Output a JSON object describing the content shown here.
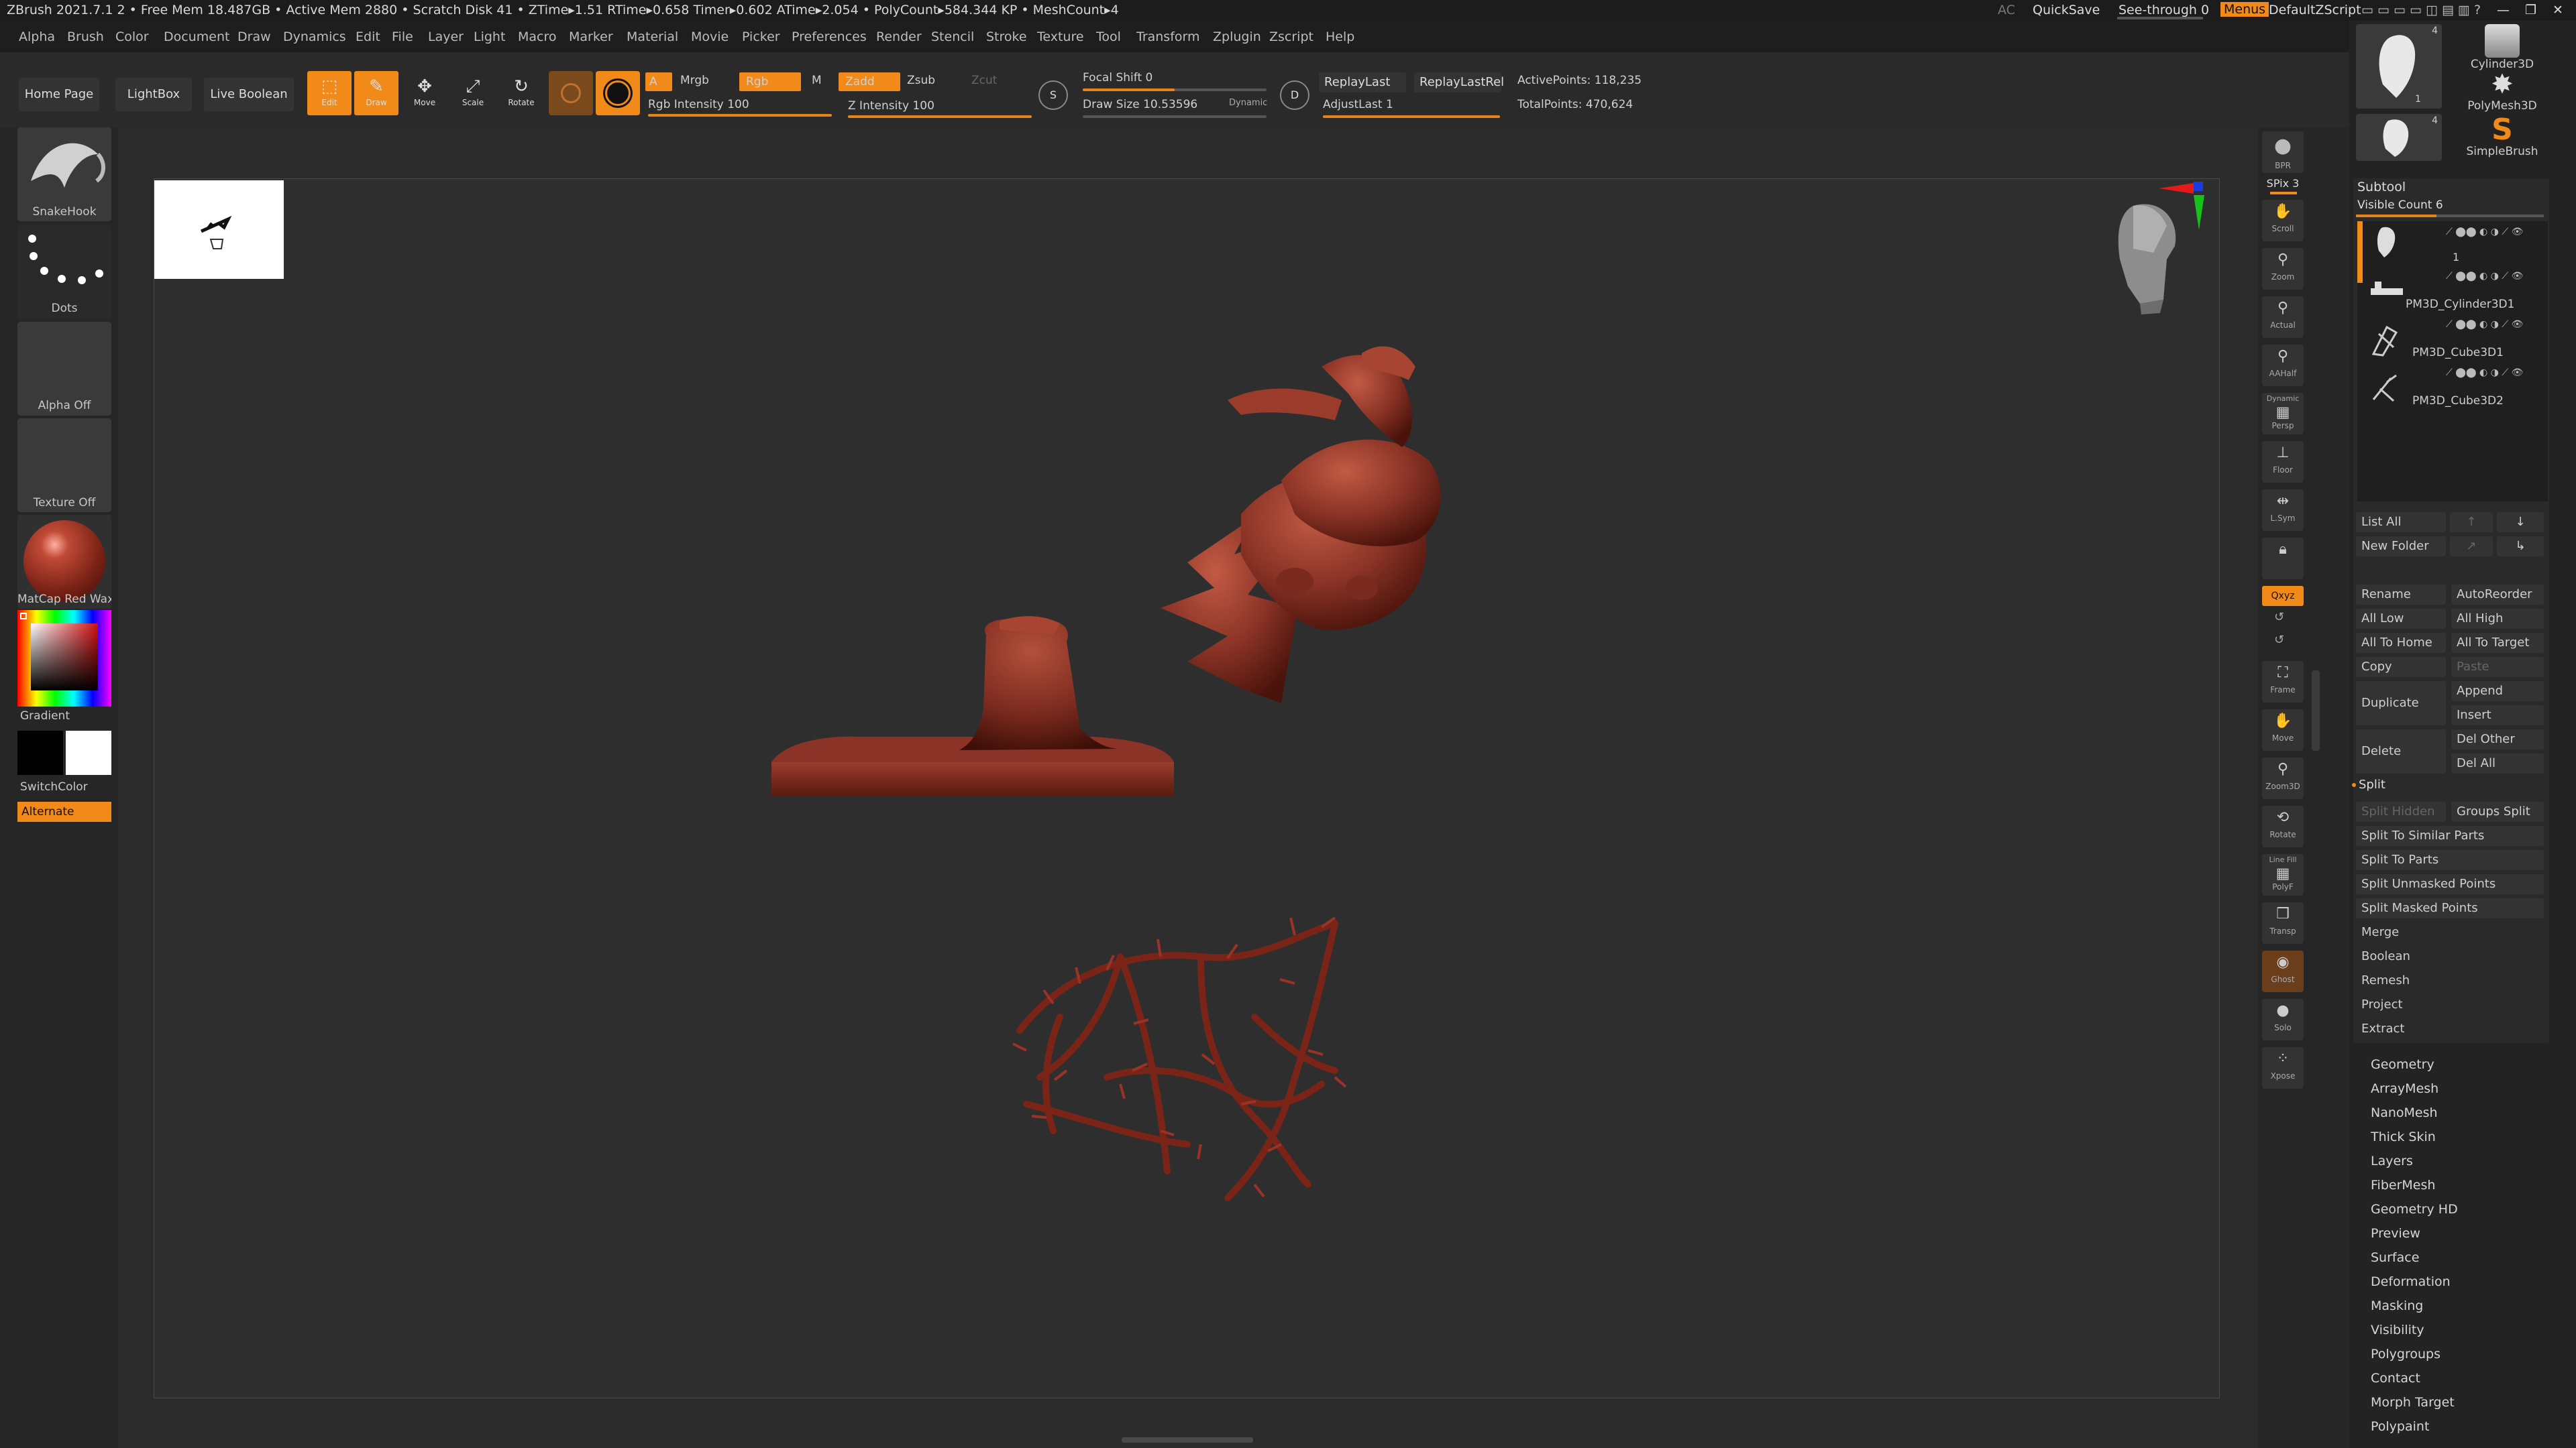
{
  "titlebar": {
    "status": "ZBrush 2021.7.1   2  • Free Mem 18.487GB • Active Mem 2880 • Scratch Disk 41 •  ZTime▸1.51 RTime▸0.658 Timer▸0.602 ATime▸2.054 • PolyCount▸584.344 KP  • MeshCount▸4",
    "ac": "AC",
    "quicksave": "QuickSave",
    "seethrough": "See-through  0",
    "menus": "Menus",
    "script": "DefaultZScript"
  },
  "menubar": [
    "Alpha",
    "Brush",
    "Color",
    "Document",
    "Draw",
    "Dynamics",
    "Edit",
    "File",
    "Layer",
    "Light",
    "Macro",
    "Marker",
    "Material",
    "Movie",
    "Picker",
    "Preferences",
    "Render",
    "Stencil",
    "Stroke",
    "Texture",
    "Tool",
    "Transform",
    "Zplugin",
    "Zscript",
    "Help"
  ],
  "topshelf": {
    "home": "Home Page",
    "lightbox": "LightBox",
    "liveboolean": "Live Boolean",
    "edit": "Edit",
    "draw": "Draw",
    "move": "Move",
    "scale": "Scale",
    "rotate": "Rotate",
    "a": "A",
    "mrgb": "Mrgb",
    "rgb": "Rgb",
    "m": "M",
    "zadd": "Zadd",
    "zsub": "Zsub",
    "zcut": "Zcut",
    "rgb_intensity": "Rgb Intensity 100",
    "z_intensity": "Z Intensity 100",
    "focal_shift": "Focal Shift 0",
    "draw_size": "Draw Size 10.53596",
    "dynamic": "Dynamic",
    "replaylast": "ReplayLast",
    "replaylastrel": "ReplayLastRel",
    "adjustlast": "AdjustLast 1",
    "activepoints": "ActivePoints: 118,235",
    "totalpoints": "TotalPoints: 470,624",
    "s_label": "S",
    "d_label": "D",
    "rgb_intensity_level": 1.0,
    "z_intensity_level": 1.0,
    "focal_shift_level": 0.5,
    "draw_size_level": 0.0,
    "adjustlast_level": 1.0
  },
  "leftshelf": {
    "brush": "SnakeHook",
    "stroke": "Dots",
    "alpha": "Alpha Off",
    "texture": "Texture Off",
    "material": "MatCap Red Wax",
    "gradient": "Gradient",
    "switchcolor": "SwitchColor",
    "alternate": "Alternate"
  },
  "rightshelf": {
    "bpr": "BPR",
    "spix": "SPix 3",
    "buttons": [
      "Scroll",
      "Zoom",
      "Actual",
      "AAHalf",
      "Persp",
      "Floor",
      "L.Sym",
      "",
      "Qxyz",
      "",
      "",
      "Frame",
      "Move",
      "Zoom3D",
      "Rotate",
      "PolyF",
      "Transp",
      "Ghost",
      "Solo",
      "Xpose"
    ],
    "dynamic": "Dynamic",
    "linefill": "Line Fill"
  },
  "tray": {
    "tools": [
      {
        "name": "",
        "count": "4"
      },
      {
        "name": "Cylinder3D",
        "count": ""
      },
      {
        "name": "",
        "count": "1"
      },
      {
        "name": "PolyMesh3D",
        "count": ""
      },
      {
        "name": "",
        "count": "4"
      },
      {
        "name": "SimpleBrush",
        "count": ""
      }
    ],
    "subtool_title": "Subtool",
    "visible_count": "Visible Count 6",
    "subtools": [
      {
        "name": "",
        "num": "1"
      },
      {
        "name": "PM3D_Cylinder3D1",
        "num": ""
      },
      {
        "name": "PM3D_Cube3D1",
        "num": ""
      },
      {
        "name": "PM3D_Cube3D2",
        "num": ""
      }
    ],
    "list_all": "List All",
    "new_folder": "New Folder",
    "rename": "Rename",
    "autoreorder": "AutoReorder",
    "all_low": "All Low",
    "all_high": "All High",
    "all_to_home": "All To Home",
    "all_to_target": "All To Target",
    "copy": "Copy",
    "paste": "Paste",
    "duplicate": "Duplicate",
    "append": "Append",
    "insert": "Insert",
    "delete": "Delete",
    "del_other": "Del Other",
    "del_all": "Del All",
    "split": "Split",
    "split_hidden": "Split Hidden",
    "groups_split": "Groups Split",
    "split_similar": "Split To Similar Parts",
    "split_parts": "Split To Parts",
    "split_unmasked": "Split Unmasked Points",
    "split_masked": "Split Masked Points",
    "merge": "Merge",
    "boolean": "Boolean",
    "remesh": "Remesh",
    "project": "Project",
    "extract": "Extract",
    "sections": [
      "Geometry",
      "ArrayMesh",
      "NanoMesh",
      "Thick Skin",
      "Layers",
      "FiberMesh",
      "Geometry HD",
      "Preview",
      "Surface",
      "Deformation",
      "Masking",
      "Visibility",
      "Polygroups",
      "Contact",
      "Morph Target",
      "Polypaint"
    ]
  },
  "colors": {
    "accent": "#f28a1a",
    "clay": "#8a3326",
    "panel": "#262626"
  }
}
